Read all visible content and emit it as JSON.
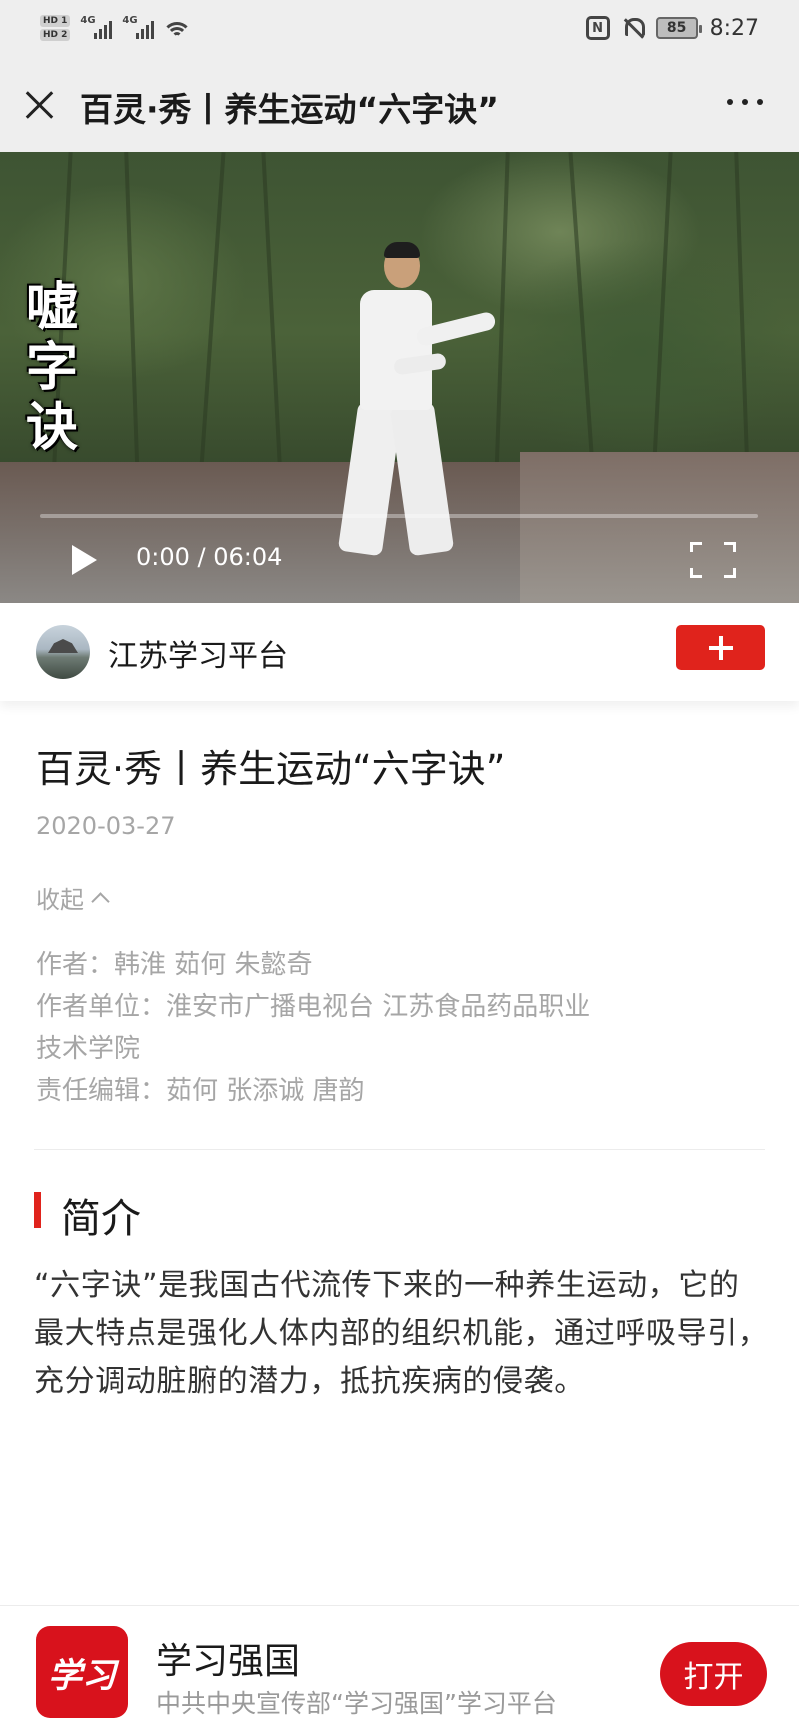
{
  "status_bar": {
    "sim1_tag": "HD 1",
    "sim2_tag": "HD 2",
    "net1": "4G",
    "net2": "4G",
    "battery_level": "85",
    "time": "8:27",
    "icons": [
      "nfc-icon",
      "mute-bell-icon",
      "battery-icon",
      "wifi-icon",
      "signal-icon"
    ]
  },
  "nav": {
    "title": "百灵·秀丨养生运动“六字诀”",
    "icons": [
      "close-icon",
      "more-icon"
    ]
  },
  "video": {
    "overlay_chars": [
      "嘘",
      "字",
      "诀"
    ],
    "current_time": "0:00",
    "separator": " / ",
    "duration": "06:04",
    "progress": 0,
    "icons": [
      "play-icon",
      "fullscreen-icon"
    ]
  },
  "publisher": {
    "name": "江苏学习平台",
    "follow_icon": "plus-icon"
  },
  "article": {
    "title": "百灵·秀丨养生运动“六字诀”",
    "date": "2020-03-27",
    "collapse_label": "收起",
    "authors": "作者：韩淮 茹何 朱懿奇",
    "units_line1": "作者单位：淮安市广播电视台 江苏食品药品职业",
    "units_line2": "技术学院",
    "editors": "责任编辑：茹何 张添诚 唐韵",
    "section_title": "简介",
    "intro": "“六字诀”是我国古代流传下来的一种养生运动，它的最大特点是强化人体内部的组织机能，通过呼吸导引，充分调动脏腑的潜力，抵抗疾病的侵袭。"
  },
  "app_banner": {
    "logo_text": "学习",
    "name": "学习强国",
    "description": "中共中央宣传部“学习强国”学习平台",
    "open_label": "打开"
  },
  "colors": {
    "accent_red": "#e0231c",
    "banner_red": "#d8121c",
    "muted_text": "#a6a6a6"
  }
}
